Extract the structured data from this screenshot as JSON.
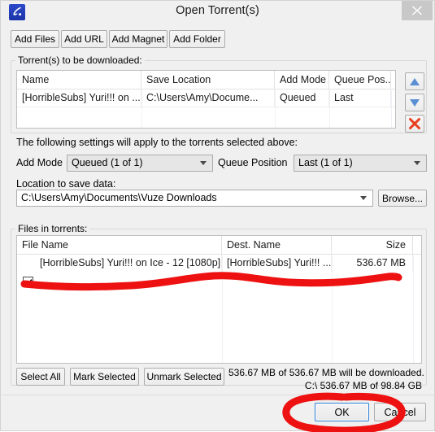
{
  "window": {
    "title": "Open Torrent(s)",
    "app_icon": "vuze-icon",
    "close_label": "×"
  },
  "toolbar": {
    "buttons": [
      {
        "label": "Add Files",
        "name": "add-files-button"
      },
      {
        "label": "Add URL",
        "name": "add-url-button"
      },
      {
        "label": "Add Magnet",
        "name": "add-magnet-button"
      },
      {
        "label": "Add Folder",
        "name": "add-folder-button"
      }
    ]
  },
  "torrents_group": {
    "label": "Torrent(s) to be downloaded:",
    "columns": [
      "Name",
      "Save Location",
      "Add Mode",
      "Queue Pos..."
    ],
    "rows": [
      {
        "name": "[HorribleSubs] Yuri!!! on ...",
        "save_location": "C:\\Users\\Amy\\Docume...",
        "add_mode": "Queued",
        "queue_pos": "Last"
      }
    ],
    "side_buttons": [
      {
        "name": "move-up-button",
        "icon": "triangle-up-icon"
      },
      {
        "name": "move-down-button",
        "icon": "triangle-down-icon"
      },
      {
        "name": "remove-button",
        "icon": "red-x-icon"
      }
    ]
  },
  "settings": {
    "note": "The following settings will apply to the torrents selected above:",
    "add_mode_label": "Add Mode",
    "add_mode_value": "Queued (1 of 1)",
    "queue_position_label": "Queue Position",
    "queue_position_value": "Last (1 of 1)",
    "location_label": "Location to save data:",
    "location_value": "C:\\Users\\Amy\\Documents\\Vuze Downloads",
    "browse_label": "Browse..."
  },
  "files_group": {
    "label": "Files in torrents:",
    "columns": [
      "File Name",
      "Dest. Name",
      "Size"
    ],
    "rows": [
      {
        "checked": true,
        "file_name": "[HorribleSubs] Yuri!!! on Ice - 12 [1080p]...",
        "dest_name": "[HorribleSubs] Yuri!!! ...",
        "size": "536.67 MB"
      }
    ],
    "buttons": [
      {
        "label": "Select All",
        "name": "select-all-button"
      },
      {
        "label": "Mark Selected",
        "name": "mark-selected-button"
      },
      {
        "label": "Unmark Selected",
        "name": "unmark-selected-button"
      }
    ],
    "status_line_1": "536.67 MB of 536.67 MB will be downloaded.",
    "status_line_2": "C:\\      536.67 MB of 98.84 GB"
  },
  "footer": {
    "ok_label": "OK",
    "cancel_label": "Cancel"
  },
  "annotations": {
    "color": "#ee1111",
    "strike_through_files_row": true,
    "circle_ok_button": true
  }
}
